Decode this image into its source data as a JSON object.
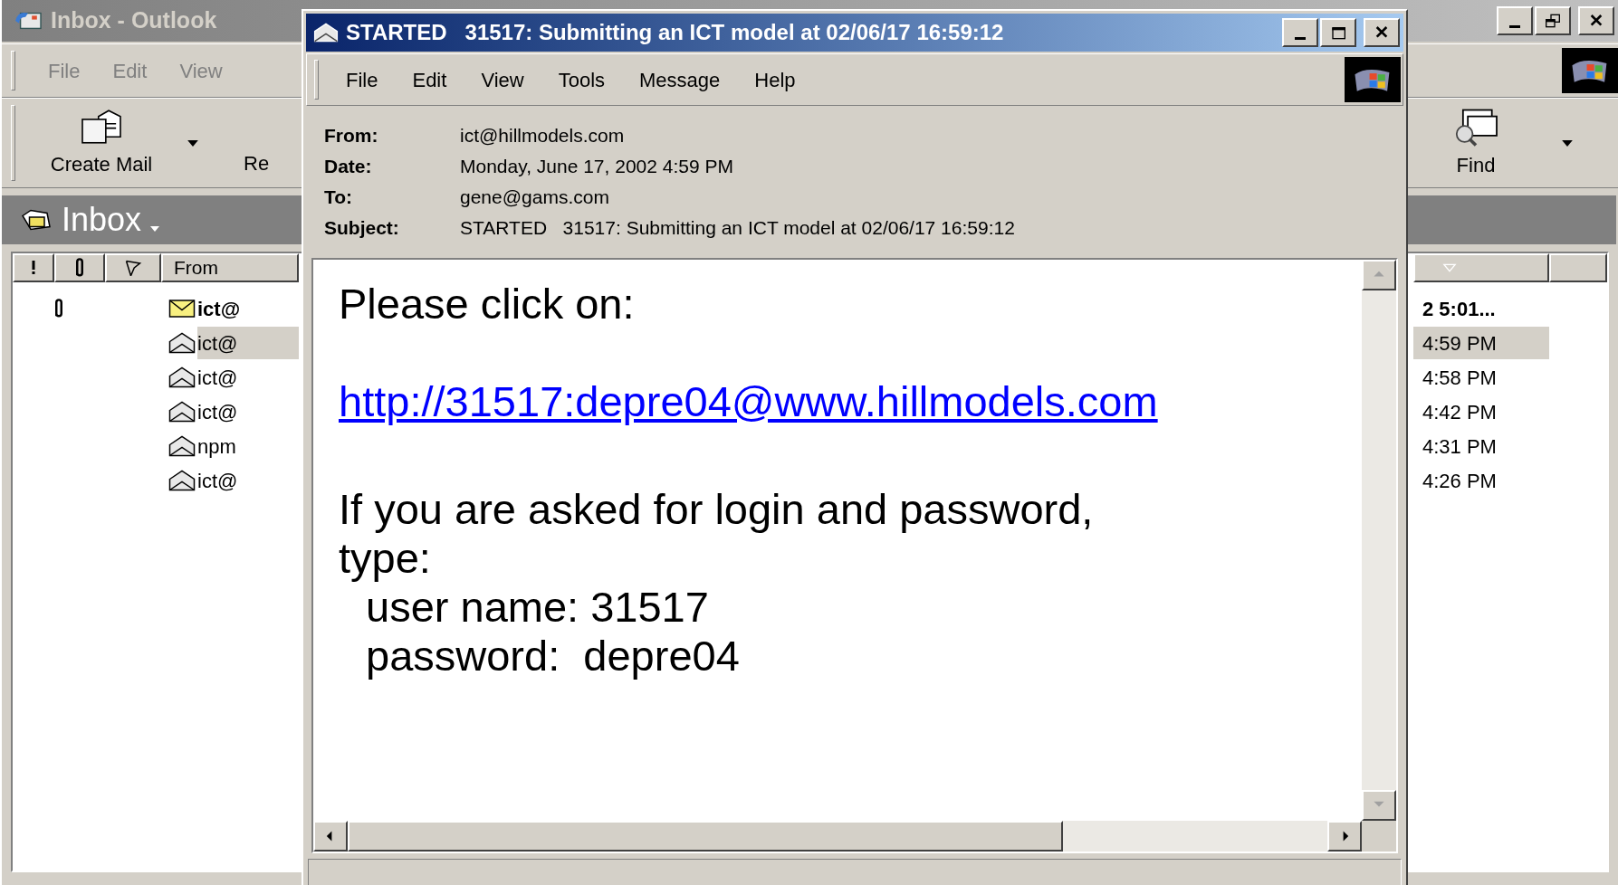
{
  "background_window": {
    "title": "Inbox - Outlook",
    "menu": [
      "File",
      "Edit",
      "View"
    ],
    "toolbar_left": [
      {
        "label": "Create Mail",
        "kind": "create"
      },
      {
        "label": "Re",
        "kind": "partial"
      }
    ],
    "toolbar_right": [
      {
        "label": "Find",
        "kind": "find"
      }
    ],
    "folder_title": "Inbox",
    "columns": [
      {
        "kind": "priority"
      },
      {
        "kind": "attachment"
      },
      {
        "kind": "flag"
      },
      {
        "kind": "text",
        "label": "From"
      }
    ],
    "rows": [
      {
        "from": "ict@",
        "received": "2 5:01...",
        "read": false,
        "attachment": true,
        "selected": false
      },
      {
        "from": "ict@",
        "received": "4:59 PM",
        "read": true,
        "attachment": false,
        "selected": true
      },
      {
        "from": "ict@",
        "received": "4:58 PM",
        "read": true,
        "attachment": false,
        "selected": false
      },
      {
        "from": "ict@",
        "received": "4:42 PM",
        "read": true,
        "attachment": false,
        "selected": false
      },
      {
        "from": "npm",
        "received": "4:31 PM",
        "read": true,
        "attachment": false,
        "selected": false
      },
      {
        "from": "ict@",
        "received": "4:26 PM",
        "read": true,
        "attachment": false,
        "selected": false
      }
    ]
  },
  "message_window": {
    "title": "STARTED   31517: Submitting an ICT model at 02/06/17 16:59:12",
    "menu": [
      "File",
      "Edit",
      "View",
      "Tools",
      "Message",
      "Help"
    ],
    "headers": [
      {
        "label": "From:",
        "value": "ict@hillmodels.com"
      },
      {
        "label": "Date:",
        "value": "Monday, June 17, 2002 4:59 PM"
      },
      {
        "label": "To:",
        "value": "gene@gams.com"
      },
      {
        "label": "Subject:",
        "value": "STARTED   31517: Submitting an ICT model at 02/06/17 16:59:12"
      }
    ],
    "body": [
      {
        "kind": "text",
        "text": "Please click on:"
      },
      {
        "kind": "gap"
      },
      {
        "kind": "link",
        "text": "http://31517:depre04@www.hillmodels.com"
      },
      {
        "kind": "gap"
      },
      {
        "kind": "text",
        "text": "If you are asked for login and password,"
      },
      {
        "kind": "text",
        "text": "type:"
      },
      {
        "kind": "indented",
        "text": "user name: 31517"
      },
      {
        "kind": "indented",
        "text": "password:  depre04"
      }
    ]
  }
}
